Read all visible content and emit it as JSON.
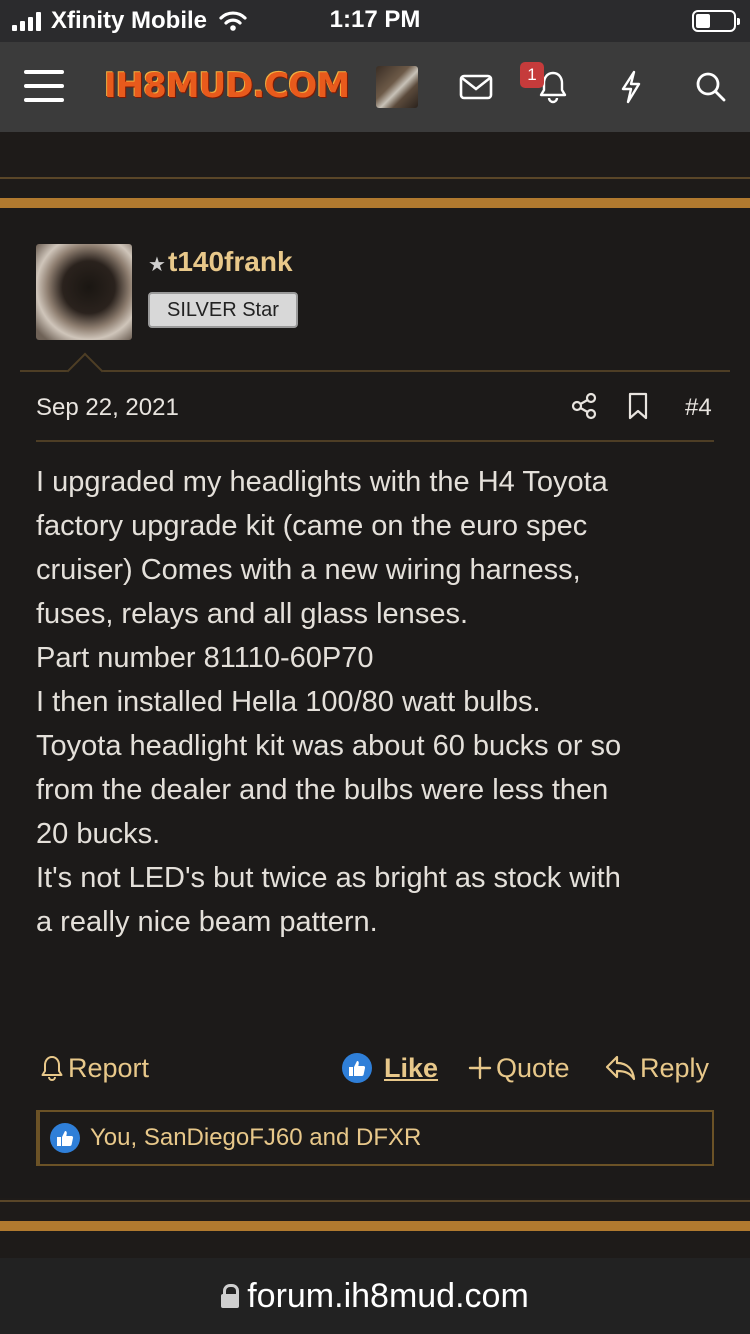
{
  "status_bar": {
    "carrier": "Xfinity Mobile",
    "time": "1:17 PM"
  },
  "header": {
    "logo_text": "IH8MUD.COM",
    "notification_count": "1",
    "icons": [
      "menu-icon",
      "avatar",
      "envelope-icon",
      "bell-icon",
      "lightning-icon",
      "search-icon"
    ]
  },
  "post": {
    "username": "t140frank",
    "rank": "SILVER Star",
    "date": "Sep 22, 2021",
    "number": "#4",
    "body_lines": [
      "I upgraded my headlights with the H4 Toyota",
      "factory upgrade kit (came on the euro spec",
      "cruiser) Comes with a new wiring harness,",
      "fuses, relays and all glass lenses.",
      "Part number 81110-60P70",
      "I then installed Hella 100/80 watt bulbs.",
      "Toyota headlight kit was about 60 bucks or so",
      "from the dealer and the bulbs were less then",
      "20 bucks.",
      "It's not LED's but twice as bright as stock with",
      "a really nice beam pattern."
    ],
    "actions": {
      "report": "Report",
      "like": "Like",
      "quote": "Quote",
      "reply": "Reply"
    },
    "likes_summary": "You, SanDiegoFJ60 and DFXR"
  },
  "browser": {
    "url": "forum.ih8mud.com"
  },
  "colors": {
    "accent": "#b17a2f",
    "link": "#e8c88a",
    "badge": "#c53b3b",
    "like": "#2f7fd8"
  }
}
